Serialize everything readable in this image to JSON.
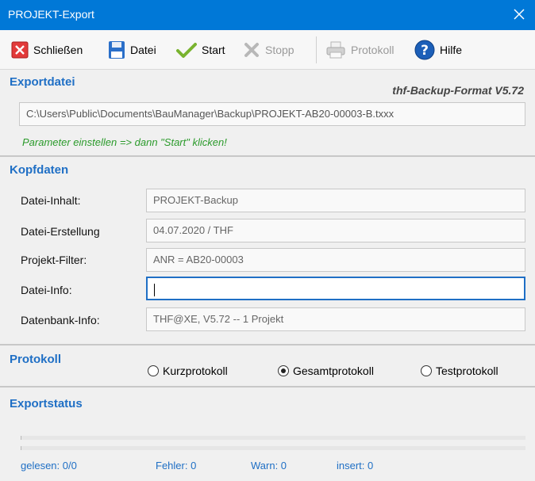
{
  "window": {
    "title": "PROJEKT-Export"
  },
  "toolbar": {
    "close_label": "Schließen",
    "file_label": "Datei",
    "start_label": "Start",
    "stop_label": "Stopp",
    "log_label": "Protokoll",
    "help_label": "Hilfe"
  },
  "export_file": {
    "section_title": "Exportdatei",
    "format_label": "thf-Backup-Format V5.72",
    "path": "C:\\Users\\Public\\Documents\\BauManager\\Backup\\PROJEKT-AB20-00003-B.txxx",
    "hint": "Parameter einstellen => dann \"Start\" klicken!"
  },
  "header_data": {
    "section_title": "Kopfdaten",
    "fields": [
      {
        "label": "Datei-Inhalt:",
        "value": "PROJEKT-Backup"
      },
      {
        "label": "Datei-Erstellung",
        "value": "04.07.2020 / THF"
      },
      {
        "label": "Projekt-Filter:",
        "value": "ANR = AB20-00003"
      },
      {
        "label": "Datei-Info:",
        "value": ""
      },
      {
        "label": "Datenbank-Info:",
        "value": "THF@XE, V5.72 -- 1 Projekt"
      }
    ]
  },
  "protocol": {
    "section_title": "Protokoll",
    "options": [
      {
        "label": "Kurzprotokoll",
        "checked": false
      },
      {
        "label": "Gesamtprotokoll",
        "checked": true
      },
      {
        "label": "Testprotokoll",
        "checked": false
      }
    ]
  },
  "export_status": {
    "section_title": "Exportstatus",
    "read": "gelesen:  0/0",
    "errors": "Fehler:  0",
    "warnings": "Warn:  0",
    "insert": "insert:  0"
  },
  "colors": {
    "accent": "#0078d7",
    "section_title": "#1f6fc5",
    "hint": "#2a9a2a"
  }
}
